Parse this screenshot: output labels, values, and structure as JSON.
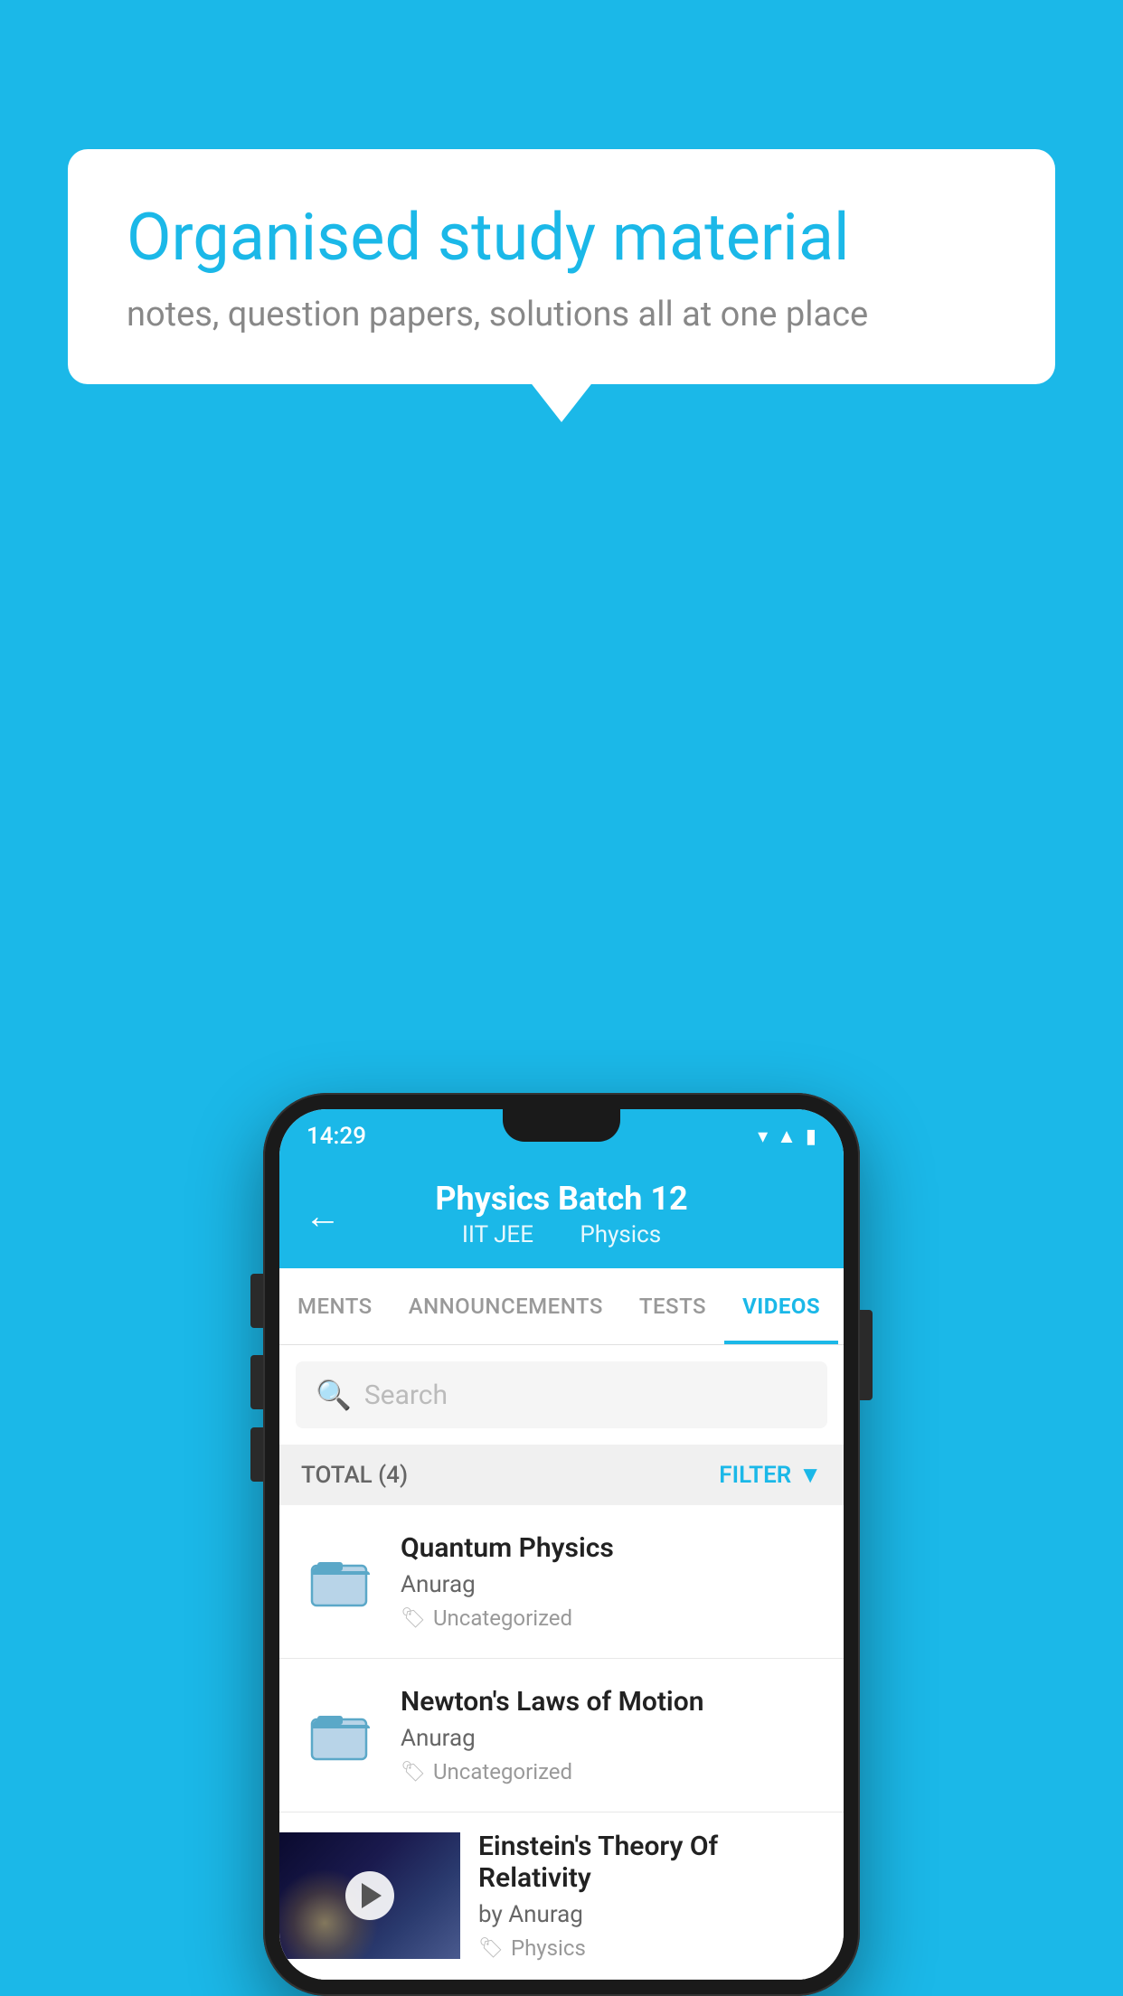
{
  "background_color": "#1BB8E8",
  "speech_bubble": {
    "title": "Organised study material",
    "subtitle": "notes, question papers, solutions all at one place"
  },
  "status_bar": {
    "time": "14:29",
    "wifi": "▾",
    "signal": "◂",
    "battery": "▮"
  },
  "app_header": {
    "back_label": "←",
    "title": "Physics Batch 12",
    "subtitle_part1": "IIT JEE",
    "subtitle_part2": "Physics"
  },
  "tabs": [
    {
      "label": "MENTS",
      "active": false
    },
    {
      "label": "ANNOUNCEMENTS",
      "active": false
    },
    {
      "label": "TESTS",
      "active": false
    },
    {
      "label": "VIDEOS",
      "active": true
    }
  ],
  "search": {
    "placeholder": "Search"
  },
  "filter_bar": {
    "total_label": "TOTAL (4)",
    "filter_label": "FILTER"
  },
  "videos": [
    {
      "id": 1,
      "title": "Quantum Physics",
      "author": "Anurag",
      "tag": "Uncategorized",
      "has_thumbnail": false
    },
    {
      "id": 2,
      "title": "Newton's Laws of Motion",
      "author": "Anurag",
      "tag": "Uncategorized",
      "has_thumbnail": false
    },
    {
      "id": 3,
      "title": "Einstein's Theory Of Relativity",
      "author": "by Anurag",
      "tag": "Physics",
      "has_thumbnail": true
    }
  ]
}
